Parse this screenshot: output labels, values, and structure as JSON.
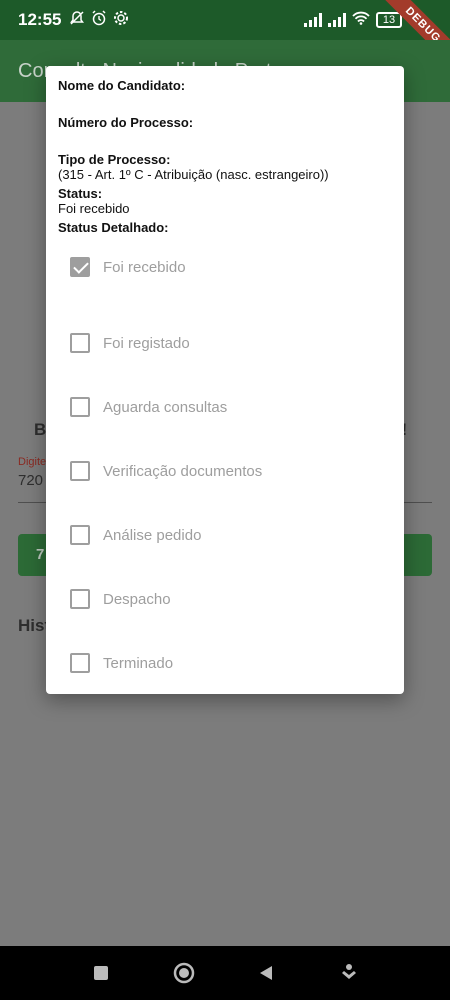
{
  "status_bar": {
    "time": "12:55",
    "battery": "13",
    "debug": "DEBUG"
  },
  "app_bar": {
    "title": "Consulta Nacionalidade Portuguesa"
  },
  "background": {
    "welcome_left": "Bo",
    "welcome_right": "a!",
    "input_label": "Digite",
    "input_value": "720",
    "button_left": "7",
    "button_right": "ar",
    "history": "Hist"
  },
  "dialog": {
    "candidate_label": "Nome do Candidato:",
    "process_number_label": "Número do Processo:",
    "process_type_label": "Tipo de Processo:",
    "process_type_value": "(315 - Art. 1º C - Atribuição (nasc. estrangeiro))",
    "status_label": "Status:",
    "status_value": "Foi recebido",
    "detailed_label": "Status Detalhado:",
    "steps": [
      {
        "label": "Foi recebido",
        "checked": true
      },
      {
        "label": "Foi registado",
        "checked": false
      },
      {
        "label": "Aguarda consultas",
        "checked": false
      },
      {
        "label": "Verificação documentos",
        "checked": false
      },
      {
        "label": "Análise pedido",
        "checked": false
      },
      {
        "label": "Despacho",
        "checked": false
      },
      {
        "label": "Terminado",
        "checked": false
      }
    ]
  },
  "colors": {
    "status_bar": "#1d5a29",
    "app_bar": "#2f6b39",
    "checkbox": "#9e9e9e",
    "debug_ribbon": "#a33b2b"
  }
}
